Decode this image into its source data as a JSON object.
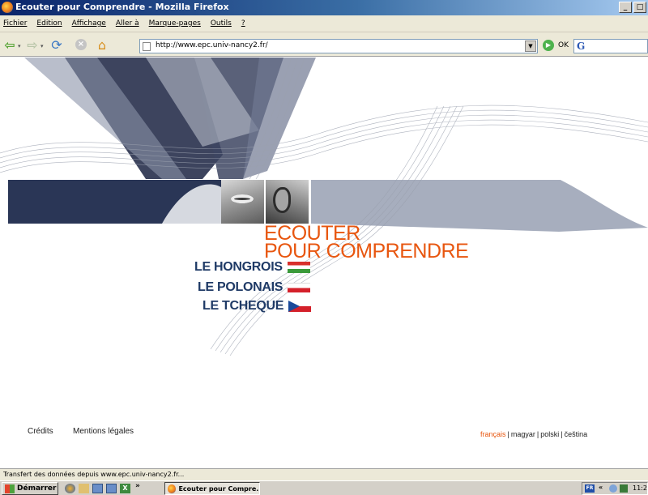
{
  "window": {
    "title": "Ecouter pour Comprendre - Mozilla Firefox"
  },
  "menu": [
    "Fichier",
    "Edition",
    "Affichage",
    "Aller à",
    "Marque-pages",
    "Outils",
    "?"
  ],
  "nav": {
    "url": "http://www.epc.univ-nancy2.fr/",
    "go_label": "OK",
    "search_label": "G"
  },
  "site": {
    "title_line1": "ECOUTER",
    "title_line2": "POUR COMPRENDRE",
    "languages": [
      {
        "label": "LE HONGROIS",
        "flag": "hungary-flag-icon"
      },
      {
        "label": "LE POLONAIS",
        "flag": "poland-flag-icon"
      },
      {
        "label": "LE TCHEQUE",
        "flag": "czech-flag-icon"
      }
    ],
    "footer": {
      "credits": "Crédits",
      "legal": "Mentions légales"
    },
    "language_switch": {
      "active": "français",
      "others": [
        "magyar",
        "polski",
        "čeština"
      ]
    }
  },
  "status": {
    "text": "Transfert des données depuis www.epc.univ-nancy2.fr..."
  },
  "taskbar": {
    "start": "Démarrer",
    "task": "Ecouter pour Compre...",
    "tray_lang": "FR",
    "clock": "11:2"
  },
  "colors": {
    "accent": "#e8560f",
    "navy": "#1f3a66",
    "band_gray": "#a7aebe"
  }
}
